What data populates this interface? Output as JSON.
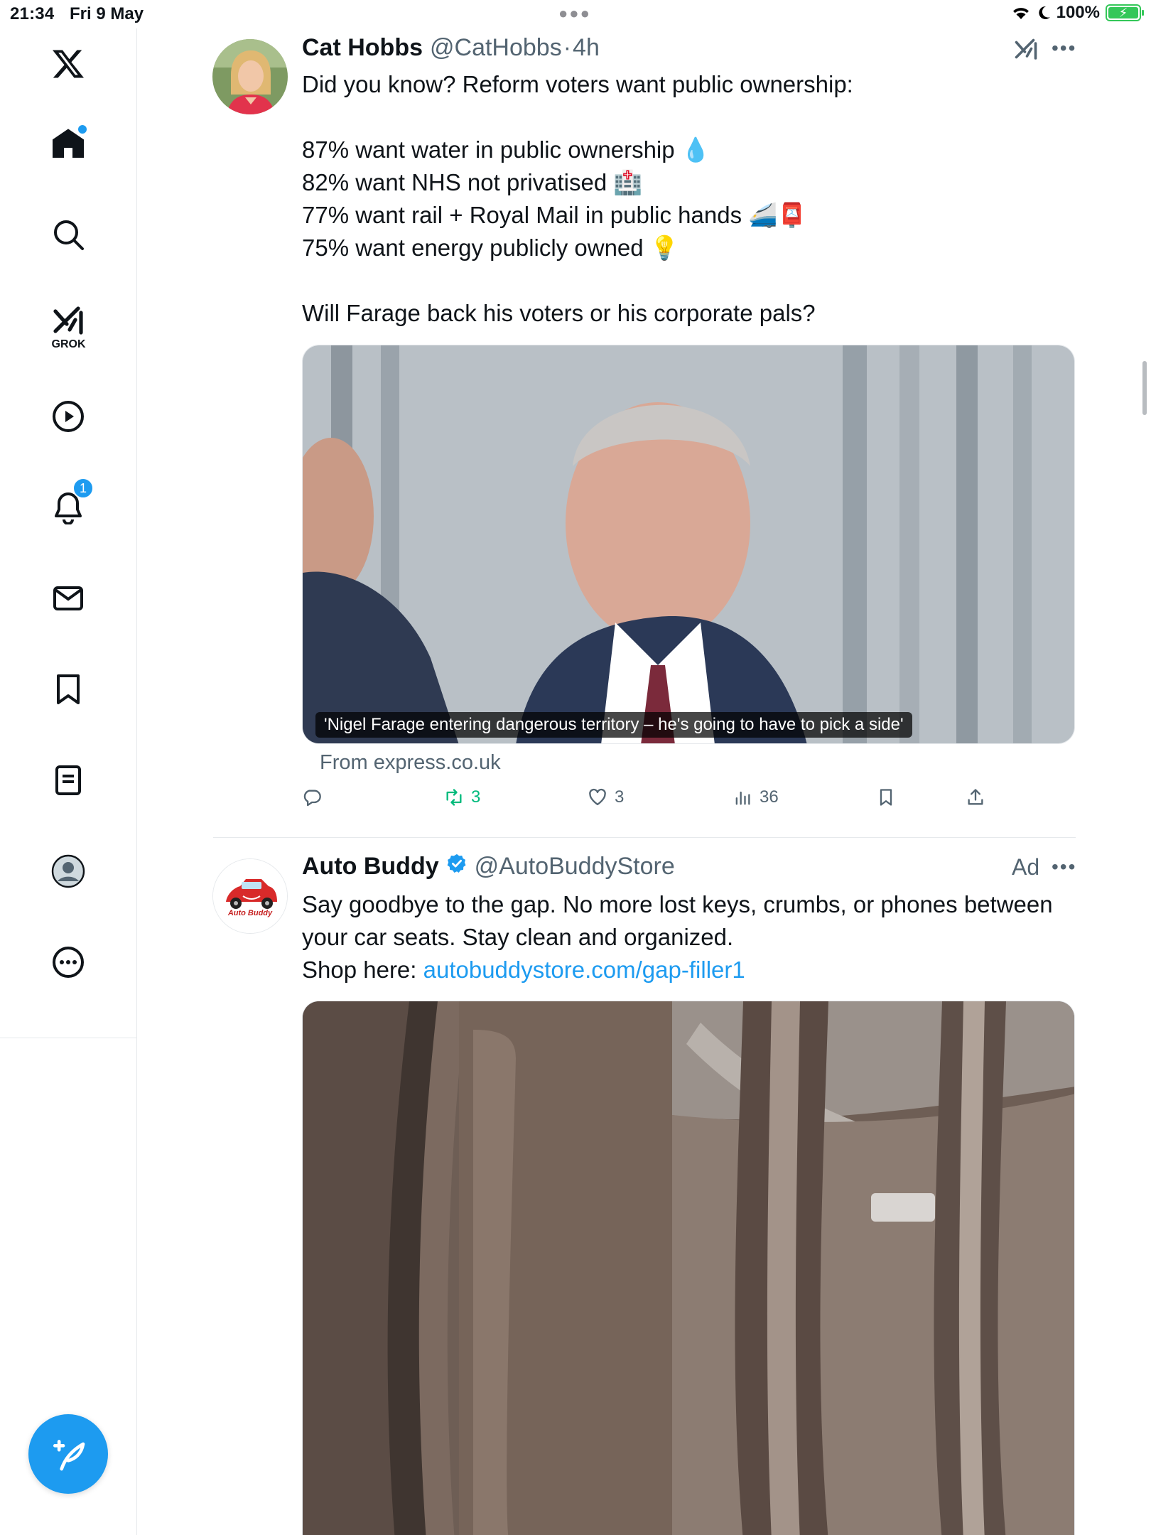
{
  "status_bar": {
    "time": "21:34",
    "date": "Fri 9 May",
    "battery": "100%"
  },
  "sidebar": {
    "items": [
      {
        "name": "x-logo-icon"
      },
      {
        "name": "home-icon",
        "has_dot": true
      },
      {
        "name": "search-icon"
      },
      {
        "name": "grok-icon",
        "label": "GROK"
      },
      {
        "name": "video-icon"
      },
      {
        "name": "notifications-icon",
        "badge": "1"
      },
      {
        "name": "messages-icon"
      },
      {
        "name": "bookmarks-icon"
      },
      {
        "name": "lists-icon"
      },
      {
        "name": "profile-icon"
      },
      {
        "name": "more-icon"
      }
    ],
    "fab": "compose-post-icon"
  },
  "colors": {
    "accent": "#1d9bf0",
    "repost": "#00ba7c",
    "secondary_text": "#536471"
  },
  "tweet1": {
    "name": "Cat Hobbs",
    "handle": "@CatHobbs",
    "separator": "·",
    "time": "4h",
    "lines": [
      "Did you know? Reform voters want public ownership:",
      "",
      "87% want water in public ownership 💧",
      "82% want NHS not privatised 🏥",
      "77% want rail + Royal Mail in public hands 🚄📮",
      "75% want energy publicly owned 💡",
      "",
      "Will Farage back his voters or his corporate pals?"
    ],
    "card_caption": "'Nigel Farage entering dangerous territory – he's going to have to pick a side'",
    "card_source": "From express.co.uk",
    "stats": {
      "replies": "",
      "reposts": "3",
      "likes": "3",
      "views": "36"
    }
  },
  "tweet2": {
    "name": "Auto Buddy",
    "handle": "@AutoBuddyStore",
    "ad_label": "Ad",
    "avatar_text": "Auto Buddy",
    "line1": "Say goodbye to the gap. No more lost keys, crumbs, or phones between",
    "line2": "your car seats. Stay clean and organized.",
    "shop_label": "Shop here: ",
    "shop_link": "autobuddystore.com/gap-filler1"
  }
}
